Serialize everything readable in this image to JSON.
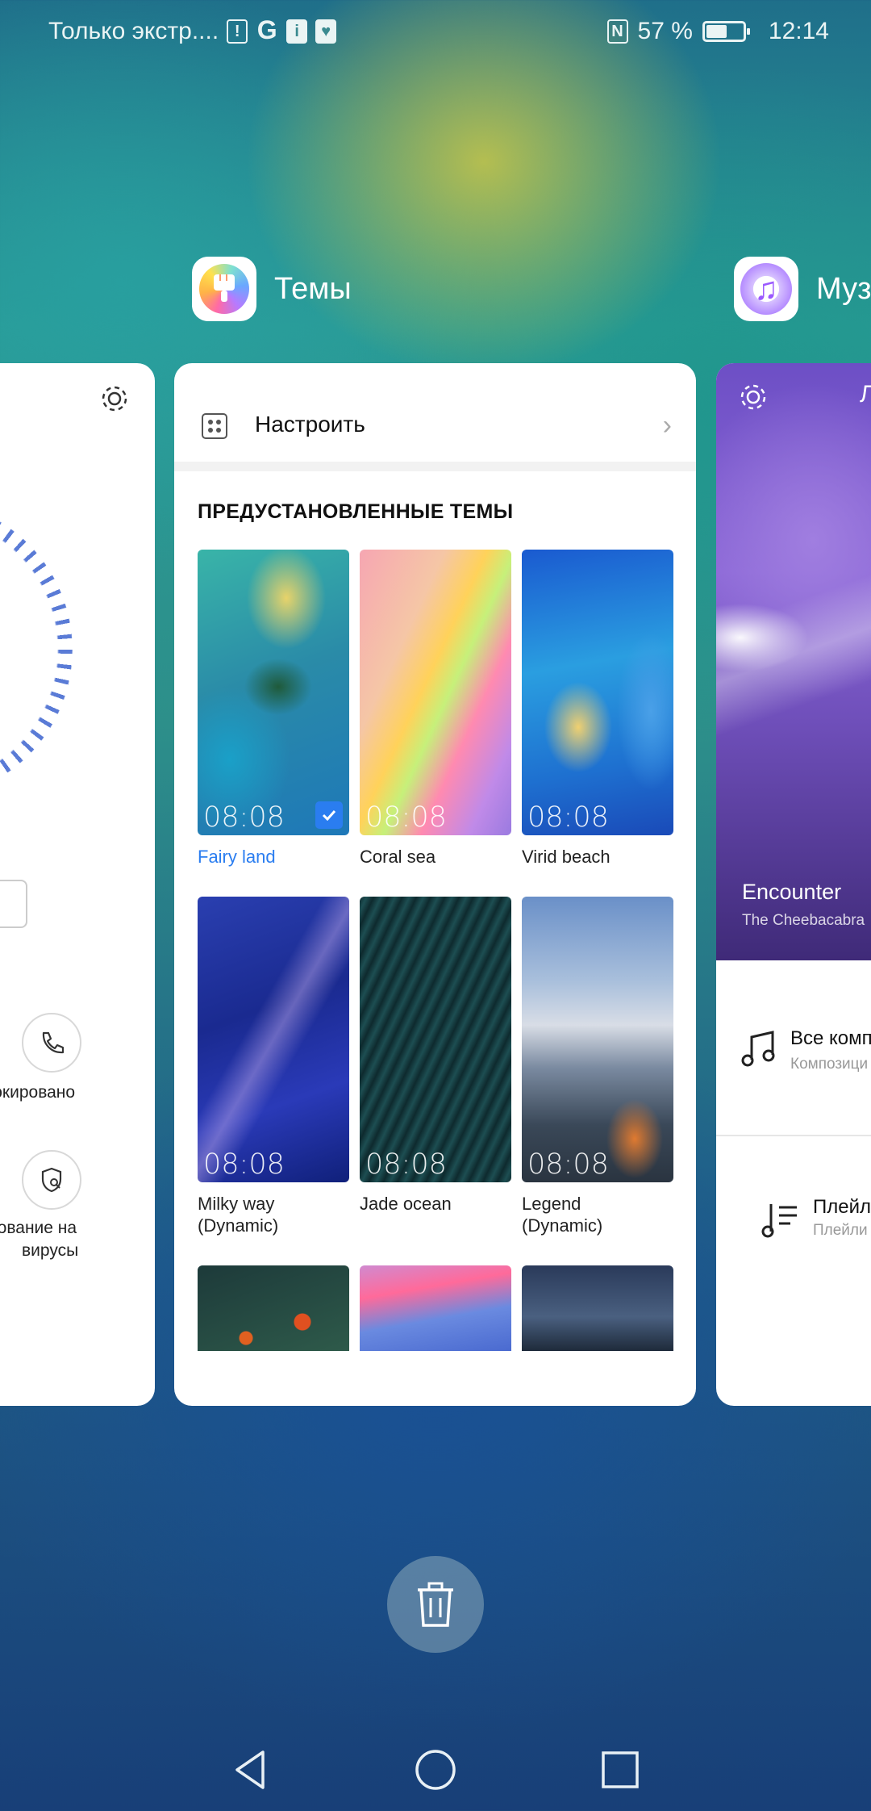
{
  "status_bar": {
    "notification_text": "Только экстр....",
    "icons": [
      "alert-icon",
      "google-icon",
      "info-icon",
      "bluetooth-icon"
    ],
    "nfc": "N",
    "battery_percent_label": "57 %",
    "battery_level": 0.57,
    "time": "12:14"
  },
  "apps": {
    "themes": {
      "name": "Темы"
    },
    "music": {
      "name": "Муз"
    }
  },
  "left_card": {
    "blocked_label": "аблокировано",
    "scan_label_line1": "анирование на",
    "scan_label_line2": "вирусы"
  },
  "themes_card": {
    "customize_label": "Настроить",
    "section_title": "ПРЕДУСТАНОВЛЕННЫЕ ТЕМЫ",
    "themes": [
      {
        "name": "Fairy land",
        "time": "08:08",
        "selected": true
      },
      {
        "name": "Coral sea",
        "time": "08:08",
        "selected": false
      },
      {
        "name": "Virid beach",
        "time": "08:08",
        "selected": false
      },
      {
        "name_line1": "Milky way",
        "name_line2": "(Dynamic)",
        "time": "08:08",
        "selected": false
      },
      {
        "name": "Jade ocean",
        "time": "08:08",
        "selected": false
      },
      {
        "name_line1": "Legend",
        "name_line2": "(Dynamic)",
        "time": "08:08",
        "selected": false
      }
    ]
  },
  "music_card": {
    "header_letter": "Л",
    "track_title": "Encounter",
    "artist": "The Cheebacabra",
    "row1_title": "Все комп",
    "row1_sub": "Композици",
    "row2_title": "Плейл",
    "row2_sub": "Плейли"
  },
  "colors": {
    "accent": "#2a7df0",
    "card_bg": "#ffffff"
  }
}
